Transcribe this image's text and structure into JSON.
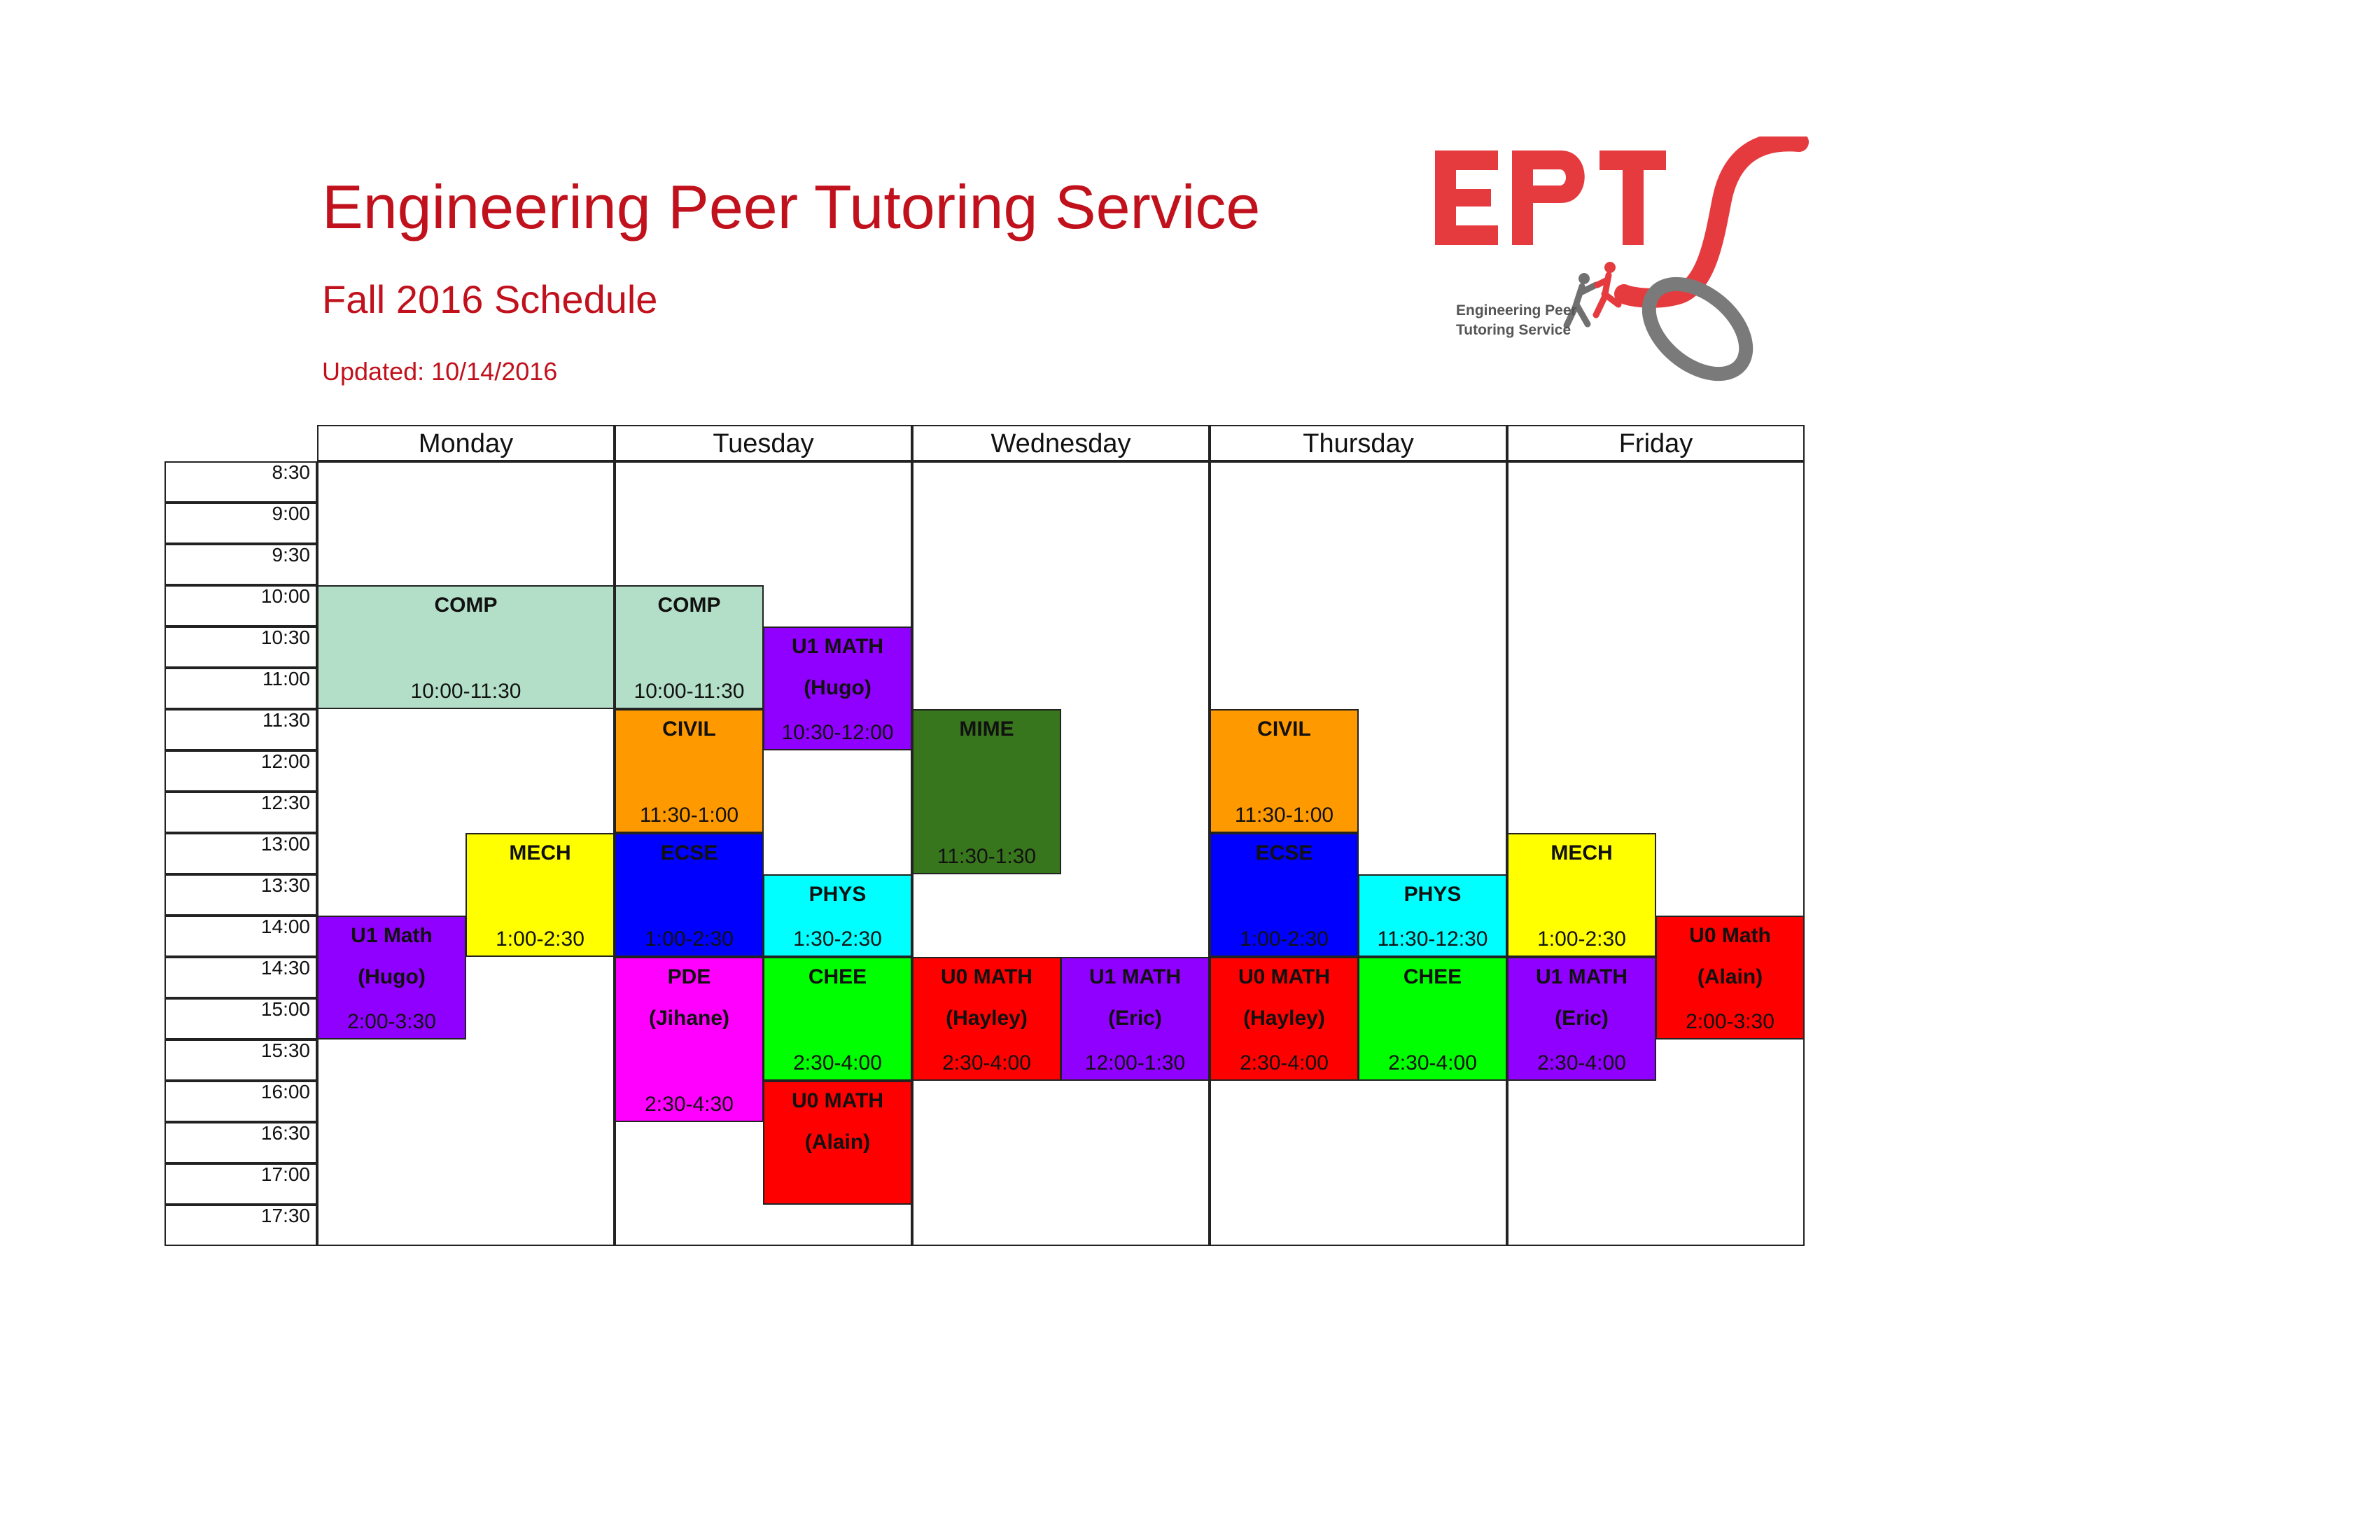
{
  "header": {
    "title": "Engineering Peer Tutoring Service",
    "subtitle": "Fall 2016 Schedule",
    "updated": "Updated: 10/14/2016"
  },
  "logo": {
    "letters": "EPTS",
    "caption_line1": "Engineering Peer",
    "caption_line2": "Tutoring Service",
    "primary_color": "#e53b3f",
    "secondary_color": "#707070"
  },
  "days": [
    "Monday",
    "Tuesday",
    "Wednesday",
    "Thursday",
    "Friday"
  ],
  "times": [
    "8:30",
    "9:00",
    "9:30",
    "10:00",
    "10:30",
    "11:00",
    "11:30",
    "12:00",
    "12:30",
    "13:00",
    "13:30",
    "14:00",
    "14:30",
    "15:00",
    "15:30",
    "16:00",
    "16:30",
    "17:00",
    "17:30"
  ],
  "sessions": [
    {
      "course": "COMP",
      "time": "10:00-11:30",
      "color": "#b3dfc8"
    },
    {
      "course": "COMP",
      "time": "10:00-11:30",
      "color": "#b3dfc8"
    },
    {
      "course": "U1 MATH",
      "tutor": "(Hugo)",
      "time": "10:30-12:00",
      "color": "#9000ff"
    },
    {
      "course": "CIVIL",
      "time": "11:30-1:00",
      "color": "#ff9900"
    },
    {
      "course": "MIME",
      "time": "11:30-1:30",
      "color": "#38761d"
    },
    {
      "course": "CIVIL",
      "time": "11:30-1:00",
      "color": "#ff9900"
    },
    {
      "course": "MECH",
      "time": "1:00-2:30",
      "color": "#ffff00"
    },
    {
      "course": "ECSE",
      "time": "1:00-2:30",
      "color": "#0000ff"
    },
    {
      "course": "PHYS",
      "time": "1:30-2:30",
      "color": "#00ffff"
    },
    {
      "course": "ECSE",
      "time": "1:00-2:30",
      "color": "#0000ff"
    },
    {
      "course": "PHYS",
      "time": "11:30-12:30",
      "color": "#00ffff"
    },
    {
      "course": "MECH",
      "time": "1:00-2:30",
      "color": "#ffff00"
    },
    {
      "course": "U1 Math",
      "tutor": "(Hugo)",
      "time": "2:00-3:30",
      "color": "#9000ff"
    },
    {
      "course": "U0 Math",
      "tutor": "(Alain)",
      "time": "2:00-3:30",
      "color": "#ff0000"
    },
    {
      "course": "PDE",
      "tutor": "(Jihane)",
      "time": "2:30-4:30",
      "color": "#ff00ff"
    },
    {
      "course": "CHEE",
      "time": "2:30-4:00",
      "color": "#00ff00"
    },
    {
      "course": "U0 MATH",
      "tutor": "(Hayley)",
      "time": "2:30-4:00",
      "color": "#ff0000"
    },
    {
      "course": "U1 MATH",
      "tutor": "(Eric)",
      "time": "12:00-1:30",
      "color": "#9000ff"
    },
    {
      "course": "U0 MATH",
      "tutor": "(Hayley)",
      "time": "2:30-4:00",
      "color": "#ff0000"
    },
    {
      "course": "CHEE",
      "time": "2:30-4:00",
      "color": "#00ff00"
    },
    {
      "course": "U1 MATH",
      "tutor": "(Eric)",
      "time": "2:30-4:00",
      "color": "#9000ff"
    },
    {
      "course": "U0 MATH",
      "tutor": "(Alain)",
      "time": "",
      "color": "#ff0000"
    }
  ]
}
